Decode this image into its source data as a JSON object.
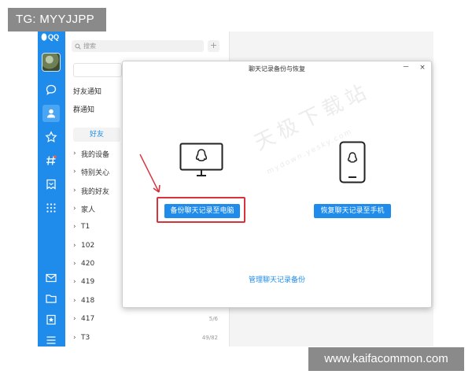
{
  "watermarks": {
    "tg": "TG: MYYJJPP",
    "site": "www.kaifacommon.com",
    "dialog_watermark": "天极下载站",
    "dialog_watermark_sub": "mydown.yesky.com"
  },
  "app": {
    "brand": "QQ"
  },
  "sidebar": {
    "nav_icons": [
      "chat-icon",
      "contacts-icon",
      "star-icon",
      "hashtag-icon",
      "bookmark-icon",
      "apps-grid-icon"
    ],
    "bottom_icons": [
      "mail-icon",
      "folder-icon",
      "favorites-icon",
      "menu-icon"
    ]
  },
  "contacts": {
    "search_placeholder": "搜索",
    "add_label": "+",
    "friend_notice": "好友通知",
    "group_notice": "群通知",
    "tab_friends": "好友",
    "groups": [
      {
        "name": "我的设备",
        "count": ""
      },
      {
        "name": "特别关心",
        "count": ""
      },
      {
        "name": "我的好友",
        "count": ""
      },
      {
        "name": "家人",
        "count": ""
      },
      {
        "name": "T1",
        "count": ""
      },
      {
        "name": "102",
        "count": ""
      },
      {
        "name": "420",
        "count": ""
      },
      {
        "name": "419",
        "count": ""
      },
      {
        "name": "418",
        "count": ""
      },
      {
        "name": "417",
        "count": "5/6"
      },
      {
        "name": "T3",
        "count": "49/82"
      }
    ]
  },
  "dialog": {
    "title": "聊天记录备份与恢复",
    "minimize": "－",
    "close": "×",
    "backup_button": "备份聊天记录至电脑",
    "restore_button": "恢复聊天记录至手机",
    "manage_link": "管理聊天记录备份"
  },
  "colors": {
    "accent": "#1f8ceb",
    "highlight": "#d8323a"
  }
}
